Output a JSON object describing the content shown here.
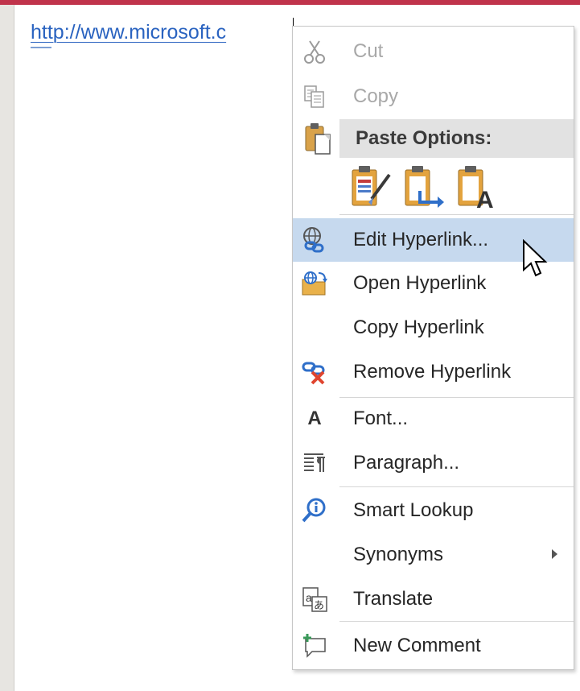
{
  "document": {
    "link_text": "http://www.microsoft.c"
  },
  "context_menu": {
    "cut": {
      "label": "Cut",
      "icon": "scissors-icon",
      "enabled": false
    },
    "copy": {
      "label": "Copy",
      "icon": "copy-icon",
      "enabled": false
    },
    "paste_options": {
      "label": "Paste Options:",
      "icon": "clipboard-icon",
      "buttons": [
        {
          "icon": "keep-source-formatting-icon"
        },
        {
          "icon": "merge-formatting-icon"
        },
        {
          "icon": "keep-text-only-icon"
        }
      ]
    },
    "edit_hyperlink": {
      "label": "Edit Hyperlink...",
      "icon": "globe-link-icon",
      "hovered": true
    },
    "open_hyperlink": {
      "label": "Open Hyperlink",
      "icon": "open-folder-globe-icon"
    },
    "copy_hyperlink": {
      "label": "Copy Hyperlink"
    },
    "remove_hyperlink": {
      "label": "Remove Hyperlink",
      "icon": "remove-link-icon"
    },
    "font": {
      "label": "Font...",
      "icon": "font-icon",
      "glyph": "A"
    },
    "paragraph": {
      "label": "Paragraph...",
      "icon": "paragraph-icon"
    },
    "smart_lookup": {
      "label": "Smart Lookup",
      "icon": "smart-lookup-icon"
    },
    "synonyms": {
      "label": "Synonyms",
      "has_submenu": true
    },
    "translate": {
      "label": "Translate",
      "icon": "translate-icon"
    },
    "new_comment": {
      "label": "New Comment",
      "icon": "new-comment-icon"
    }
  },
  "colors": {
    "accent_bar": "#c0334b",
    "hover_highlight": "#c6d9ee",
    "link": "#2a63c0"
  }
}
